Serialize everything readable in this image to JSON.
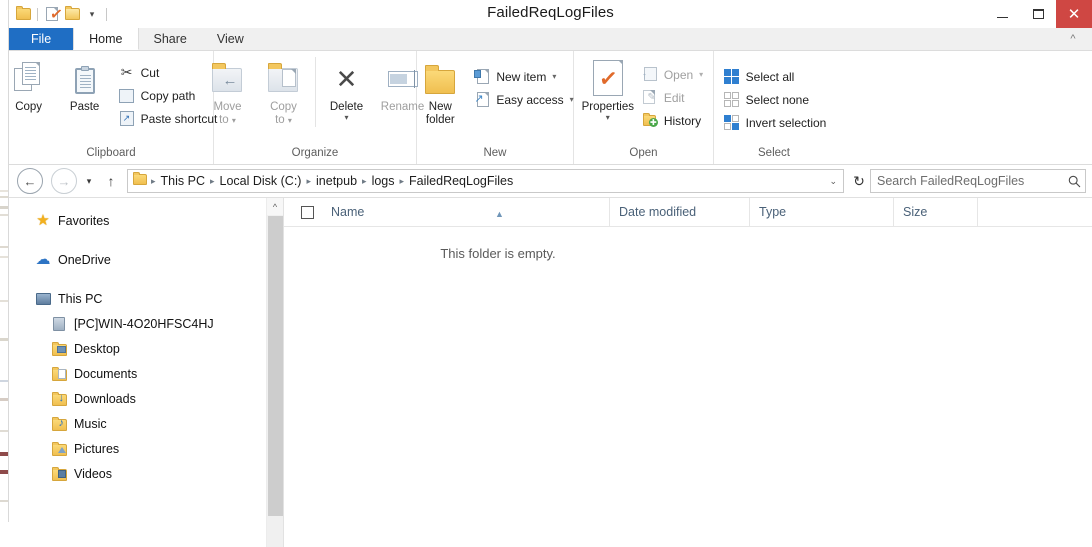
{
  "window": {
    "title": "FailedReqLogFiles",
    "controls": {
      "minimize": "—",
      "maximize": "□",
      "close": "✕"
    },
    "accent_blue": "#1f6ec4",
    "close_red": "#cf4743"
  },
  "quick_access": {
    "items": [
      {
        "name": "folder-icon",
        "label": "Folder"
      },
      {
        "name": "properties-icon",
        "label": "Properties"
      },
      {
        "name": "new-folder-icon",
        "label": "New folder"
      },
      {
        "name": "customize-dropdown-icon",
        "label": "▾"
      }
    ]
  },
  "ribbon": {
    "tabs": [
      {
        "label": "File",
        "type": "file"
      },
      {
        "label": "Home",
        "type": "active"
      },
      {
        "label": "Share",
        "type": "normal"
      },
      {
        "label": "View",
        "type": "normal"
      }
    ],
    "collapse_glyph": "⌃",
    "groups": [
      {
        "title": "Clipboard",
        "big_buttons": [
          {
            "label": "Copy",
            "icon": "copy-icon",
            "disabled": false
          },
          {
            "label": "Paste",
            "icon": "paste-icon",
            "disabled": false
          }
        ],
        "small_buttons": [
          {
            "label": "Cut",
            "icon": "scissors-icon",
            "disabled": false,
            "dropdown": false
          },
          {
            "label": "Copy path",
            "icon": "copy-path-icon",
            "disabled": false,
            "dropdown": false
          },
          {
            "label": "Paste shortcut",
            "icon": "paste-shortcut-icon",
            "disabled": false,
            "dropdown": false
          }
        ]
      },
      {
        "title": "Organize",
        "big_buttons": [
          {
            "label": "Move\nto",
            "label_line1": "Move",
            "label_line2": "to",
            "icon": "move-to-icon",
            "disabled": true,
            "dropdown": true
          },
          {
            "label": "Copy\nto",
            "label_line1": "Copy",
            "label_line2": "to",
            "icon": "copy-to-icon",
            "disabled": true,
            "dropdown": true
          },
          {
            "label": "Delete",
            "icon": "delete-icon",
            "disabled": false,
            "dropdown": true
          },
          {
            "label": "Rename",
            "icon": "rename-icon",
            "disabled": true,
            "dropdown": false
          }
        ],
        "small_buttons": []
      },
      {
        "title": "New",
        "big_buttons": [
          {
            "label_line1": "New",
            "label_line2": "folder",
            "icon": "new-folder-icon",
            "disabled": false
          }
        ],
        "small_buttons": [
          {
            "label": "New item",
            "icon": "new-item-icon",
            "disabled": false,
            "dropdown": true
          },
          {
            "label": "Easy access",
            "icon": "easy-access-icon",
            "disabled": false,
            "dropdown": true
          }
        ]
      },
      {
        "title": "Open",
        "big_buttons": [
          {
            "label": "Properties",
            "icon": "properties-icon",
            "disabled": false,
            "dropdown": true
          }
        ],
        "small_buttons": [
          {
            "label": "Open",
            "icon": "open-icon",
            "disabled": true,
            "dropdown": true
          },
          {
            "label": "Edit",
            "icon": "edit-icon",
            "disabled": true,
            "dropdown": false
          },
          {
            "label": "History",
            "icon": "history-icon",
            "disabled": false,
            "dropdown": false
          }
        ]
      },
      {
        "title": "Select",
        "big_buttons": [],
        "small_buttons": [
          {
            "label": "Select all",
            "icon": "select-all-icon",
            "disabled": false,
            "dropdown": false
          },
          {
            "label": "Select none",
            "icon": "select-none-icon",
            "disabled": false,
            "dropdown": false
          },
          {
            "label": "Invert selection",
            "icon": "invert-selection-icon",
            "disabled": false,
            "dropdown": false
          }
        ]
      }
    ]
  },
  "address_bar": {
    "back_glyph": "←",
    "forward_glyph": "→",
    "recent_glyph": "▾",
    "up_glyph": "↑",
    "breadcrumbs": [
      "This PC",
      "Local Disk (C:)",
      "inetpub",
      "logs",
      "FailedReqLogFiles"
    ],
    "separator": "▸",
    "path_dropdown_glyph": "⌄",
    "refresh_glyph": "↻",
    "search": {
      "placeholder": "Search FailedReqLogFiles",
      "value": "",
      "icon": "search-icon"
    }
  },
  "nav_pane": {
    "items": [
      {
        "label": "Favorites",
        "icon": "star-icon",
        "indent": 0,
        "spaced": false
      },
      {
        "label": "OneDrive",
        "icon": "cloud-icon",
        "indent": 0,
        "spaced": true
      },
      {
        "label": "This PC",
        "icon": "this-pc-icon",
        "indent": 0,
        "spaced": true
      },
      {
        "label": "[PC]WIN-4O20HFSC4HJ",
        "icon": "computer-icon",
        "indent": 1,
        "spaced": false
      },
      {
        "label": "Desktop",
        "icon": "desktop-folder-icon",
        "indent": 1,
        "spaced": false
      },
      {
        "label": "Documents",
        "icon": "documents-folder-icon",
        "indent": 1,
        "spaced": false
      },
      {
        "label": "Downloads",
        "icon": "downloads-folder-icon",
        "indent": 1,
        "spaced": false
      },
      {
        "label": "Music",
        "icon": "music-folder-icon",
        "indent": 1,
        "spaced": false
      },
      {
        "label": "Pictures",
        "icon": "pictures-folder-icon",
        "indent": 1,
        "spaced": false
      },
      {
        "label": "Videos",
        "icon": "videos-folder-icon",
        "indent": 1,
        "spaced": false
      }
    ],
    "scrollbar_up_glyph": "⌃"
  },
  "file_list": {
    "columns": [
      {
        "label": "Name",
        "sorted": true,
        "sort_glyph": "▲"
      },
      {
        "label": "Date modified",
        "sorted": false
      },
      {
        "label": "Type",
        "sorted": false
      },
      {
        "label": "Size",
        "sorted": false
      }
    ],
    "rows": [],
    "empty_message": "This folder is empty."
  }
}
